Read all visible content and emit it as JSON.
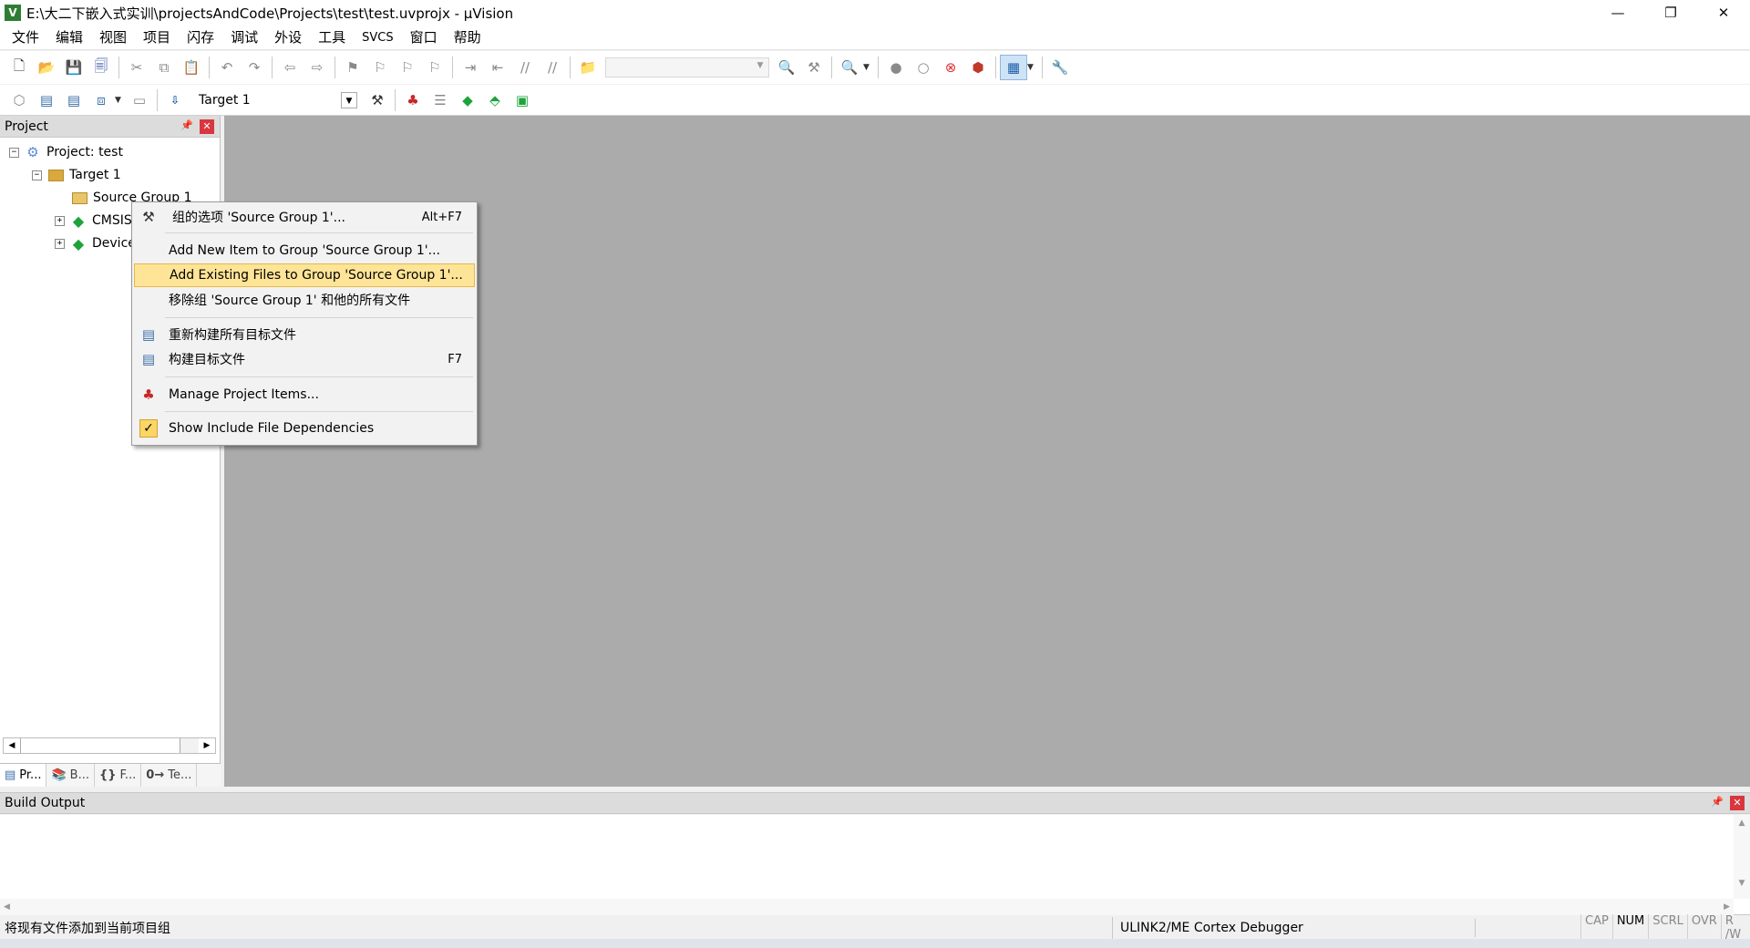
{
  "window": {
    "title": "E:\\大二下嵌入式实训\\projectsAndCode\\Projects\\test\\test.uvprojx - µVision",
    "app_icon_letter": "V",
    "minimize": "—",
    "restore": "❐",
    "close": "✕"
  },
  "menu": [
    "文件",
    "编辑",
    "视图",
    "项目",
    "闪存",
    "调试",
    "外设",
    "工具",
    "SVCS",
    "窗口",
    "帮助"
  ],
  "toolbar2": {
    "target": "Target 1"
  },
  "project_panel": {
    "title": "Project",
    "pin": "📌",
    "close": "✕",
    "tree": [
      {
        "label": "Project: test",
        "expander": "−"
      },
      {
        "label": "Target 1",
        "expander": "−"
      },
      {
        "label": "Source Group 1",
        "expander": ""
      },
      {
        "label": "CMSIS",
        "expander": "+"
      },
      {
        "label": "Device",
        "expander": "+"
      }
    ],
    "tabs": [
      "Pr...",
      "B...",
      "F...",
      "Te..."
    ]
  },
  "context_menu": {
    "items": [
      {
        "label": "组的选项 'Source Group 1'...",
        "shortcut": "Alt+F7"
      },
      {
        "label": "Add New  Item to Group 'Source Group 1'...",
        "shortcut": ""
      },
      {
        "label": "Add Existing Files to Group 'Source Group 1'...",
        "shortcut": ""
      },
      {
        "label": "移除组 'Source Group 1' 和他的所有文件",
        "shortcut": ""
      },
      {
        "label": "重新构建所有目标文件",
        "shortcut": ""
      },
      {
        "label": "构建目标文件",
        "shortcut": "F7"
      },
      {
        "label": "Manage Project Items...",
        "shortcut": ""
      },
      {
        "label": "Show Include File Dependencies",
        "shortcut": "",
        "checked": true
      }
    ],
    "highlighted_index": 2
  },
  "build_output": {
    "title": "Build Output"
  },
  "status_bar": {
    "message": "将现有文件添加到当前项目组",
    "debugger": "ULINK2/ME Cortex Debugger",
    "keys": [
      "CAP",
      "NUM",
      "SCRL",
      "OVR",
      "R /W"
    ],
    "active_key": "NUM"
  },
  "colors": {
    "highlight": "#fde496",
    "main_bg": "#ababab",
    "close_red": "#d9363e"
  }
}
